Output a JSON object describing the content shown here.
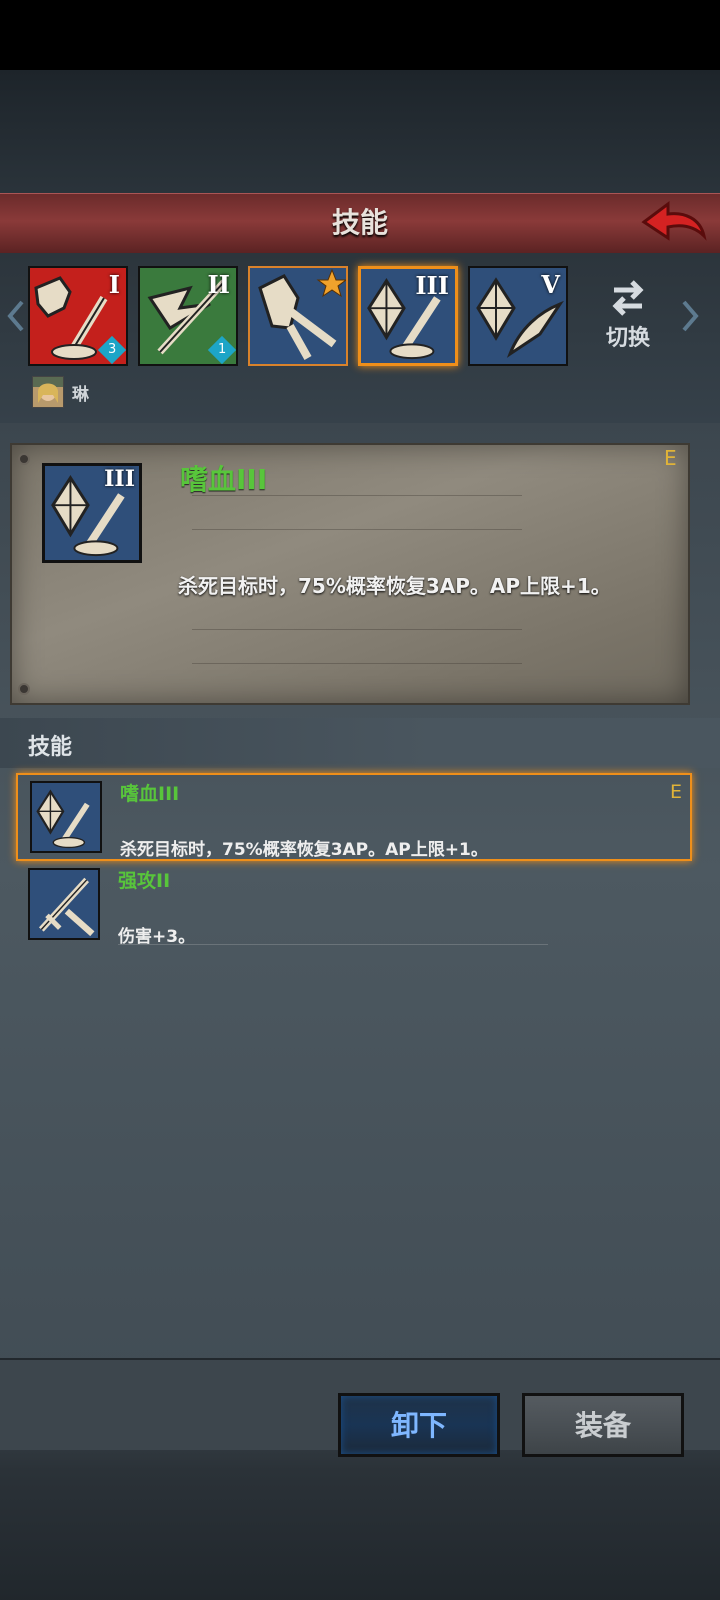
{
  "header": {
    "title": "技能",
    "back_icon": "back-arrow-icon"
  },
  "skill_slots": [
    {
      "roman": "I",
      "count": "3",
      "bg": "#c4201c",
      "icon": "fist-sword-icon"
    },
    {
      "roman": "II",
      "count": "1",
      "bg": "#3a7a3d",
      "icon": "wing-sword-icon"
    },
    {
      "roman": "",
      "count": "",
      "bg": "#2f4f7a",
      "icon": "gauntlet-star-icon"
    },
    {
      "roman": "III",
      "count": "",
      "bg": "#2f4f7a",
      "icon": "crystal-sword-icon"
    },
    {
      "roman": "V",
      "count": "",
      "bg": "#2f4f7a",
      "icon": "crystal-wing-icon"
    }
  ],
  "switch": {
    "label": "切换"
  },
  "character": {
    "name": "琳"
  },
  "detail": {
    "name": "嗜血III",
    "roman": "III",
    "grade": "E",
    "description": "杀死目标时，75%概率恢复3AP。AP上限+1。"
  },
  "section": {
    "label": "技能"
  },
  "skill_list": [
    {
      "name": "嗜血III",
      "grade": "E",
      "description": "杀死目标时，75%概率恢复3AP。AP上限+1。",
      "selected": true
    },
    {
      "name": "强攻II",
      "grade": "",
      "description": "伤害+3。",
      "selected": false
    }
  ],
  "buttons": {
    "unequip": "卸下",
    "equip": "装备"
  },
  "colors": {
    "selected_border": "#ef8f1a",
    "skill_name": "#58c53b",
    "grade": "#e0b338"
  }
}
